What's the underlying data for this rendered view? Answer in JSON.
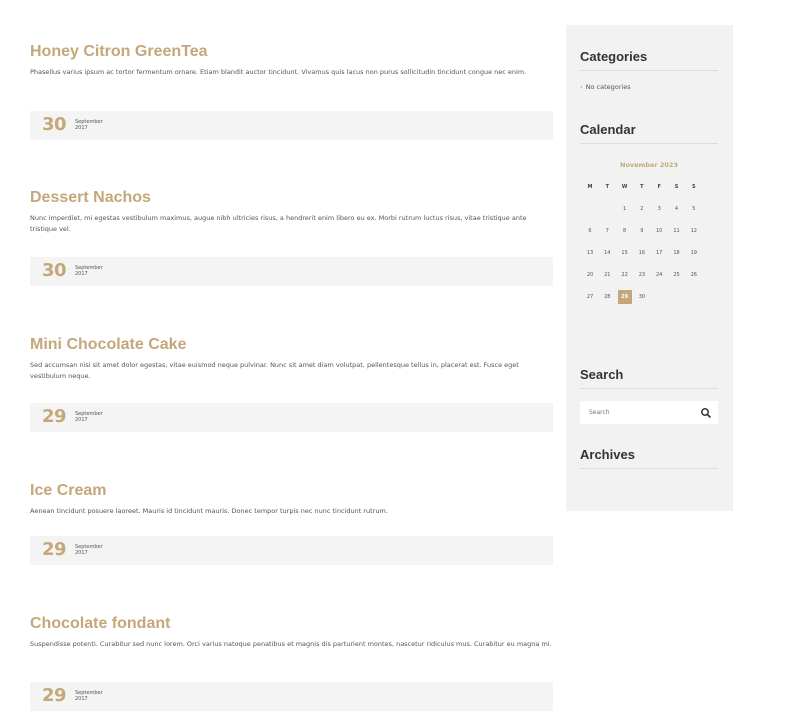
{
  "posts": [
    {
      "title": "Honey Citron GreenTea",
      "excerpt": "Phasellus varius ipsum ac tortor fermentum ornare. Etiam blandit auctor tincidunt. Vivamus quis lacus non purus sollicitudin tincidunt congue nec enim.",
      "day": "30",
      "month": "September",
      "year": "2017"
    },
    {
      "title": "Dessert Nachos",
      "excerpt": "Nunc imperdiet, mi egestas vestibulum maximus, augue nibh ultricies risus, a hendrerit enim libero eu ex. Morbi rutrum luctus risus, vitae tristique ante tristique vel.",
      "day": "30",
      "month": "September",
      "year": "2017"
    },
    {
      "title": "Mini Chocolate Cake",
      "excerpt": "Sed accumsan nisi sit amet dolor egestas, vitae euismod neque pulvinar. Nunc sit amet diam volutpat, pellentesque tellus in, placerat est. Fusce eget vestibulum neque.",
      "day": "29",
      "month": "September",
      "year": "2017"
    },
    {
      "title": "Ice Cream",
      "excerpt": "Aenean tincidunt posuere laoreet. Mauris id tincidunt mauris. Donec tempor turpis nec nunc tincidunt rutrum.",
      "day": "29",
      "month": "September",
      "year": "2017"
    },
    {
      "title": "Chocolate fondant",
      "excerpt": "Suspendisse potenti. Curabitur sed nunc lorem. Orci varius natoque penatibus et magnis dis parturient montes, nascetur ridiculus mus. Curabitur eu magna mi.",
      "day": "29",
      "month": "September",
      "year": "2017"
    }
  ],
  "sidebar": {
    "categories": {
      "title": "Categories",
      "empty_text": "No categories"
    },
    "calendar": {
      "title": "Calendar",
      "caption": "November 2023",
      "weekdays": [
        "M",
        "T",
        "W",
        "T",
        "F",
        "S",
        "S"
      ],
      "weeks": [
        [
          "",
          "",
          "1",
          "2",
          "3",
          "4",
          "5"
        ],
        [
          "6",
          "7",
          "8",
          "9",
          "10",
          "11",
          "12"
        ],
        [
          "13",
          "14",
          "15",
          "16",
          "17",
          "18",
          "19"
        ],
        [
          "20",
          "21",
          "22",
          "23",
          "24",
          "25",
          "26"
        ],
        [
          "27",
          "28",
          "29",
          "30",
          "",
          "",
          ""
        ]
      ],
      "today": "29"
    },
    "search": {
      "title": "Search",
      "placeholder": "Search",
      "icon": "search-icon"
    },
    "archives": {
      "title": "Archives"
    }
  },
  "colors": {
    "accent": "#c4a77a",
    "sidebar_bg": "#f2f2f2",
    "date_bar_bg": "#f4f4f4"
  }
}
